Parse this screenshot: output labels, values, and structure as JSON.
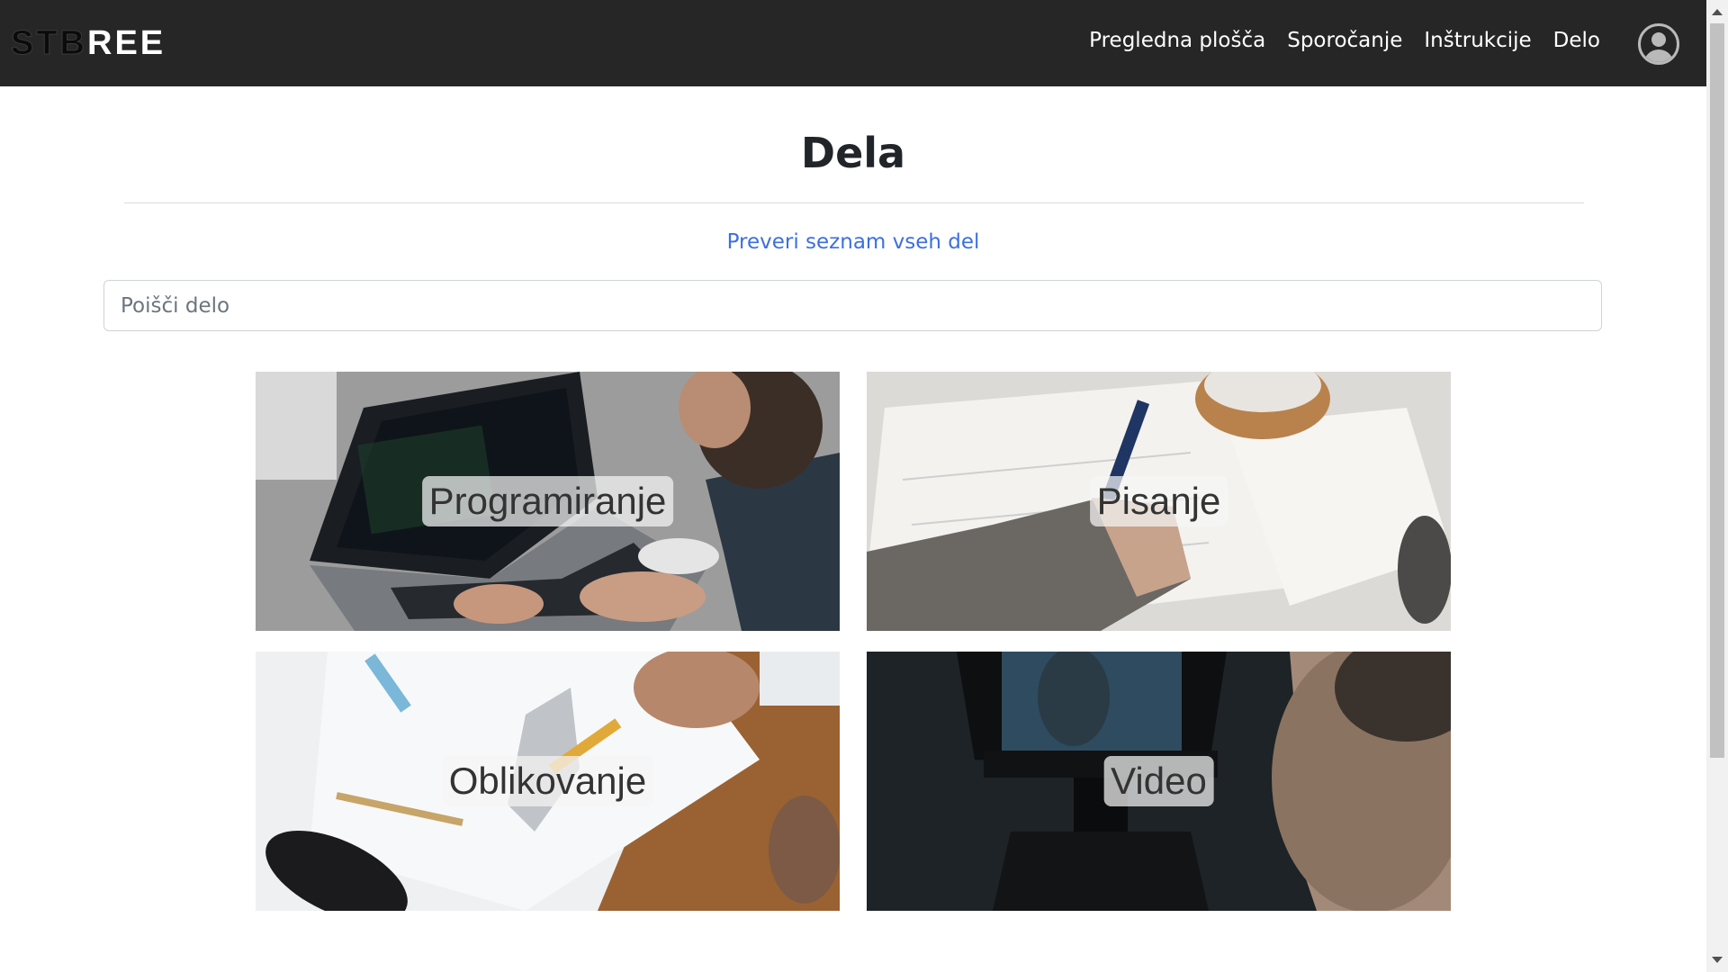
{
  "header": {
    "logo_part1": "STB",
    "logo_part2": "REE",
    "nav": [
      {
        "label": "Pregledna plošča"
      },
      {
        "label": "Sporočanje"
      },
      {
        "label": "Inštrukcije"
      },
      {
        "label": "Delo"
      }
    ],
    "avatar_icon": "user-circle-icon"
  },
  "main": {
    "title": "Dela",
    "all_jobs_link": "Preveri seznam vseh del",
    "search": {
      "placeholder": "Poišči delo",
      "value": ""
    },
    "categories": [
      {
        "label": "Programiranje",
        "image": "laptop-coding-photo"
      },
      {
        "label": "Pisanje",
        "image": "hand-writing-photo"
      },
      {
        "label": "Oblikovanje",
        "image": "design-sketch-photo"
      },
      {
        "label": "Video",
        "image": "camera-operator-photo"
      }
    ]
  },
  "colors": {
    "navbar_bg": "#262626",
    "link": "#3d6fe0",
    "text": "#212529"
  }
}
